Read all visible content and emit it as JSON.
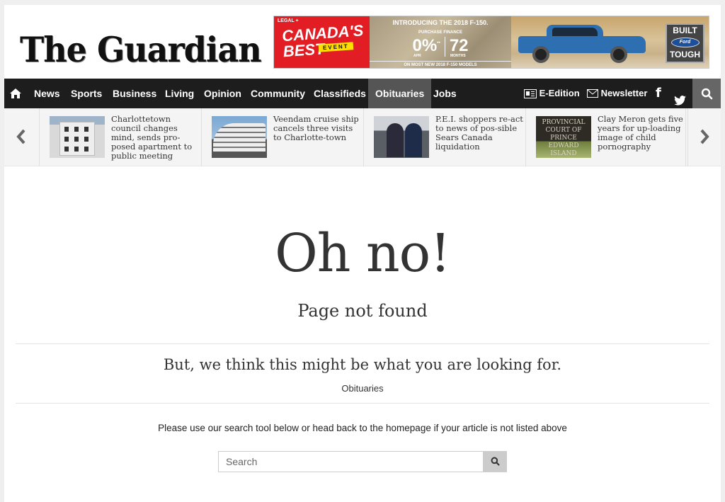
{
  "header": {
    "logo": "The Guardian",
    "ad": {
      "legal": "LEGAL +",
      "headline": "CANADA'S BEST",
      "badge": "EVENT",
      "intro": "INTRODUCING THE 2018 F-150.",
      "purchase_finance": "PURCHASE FINANCE",
      "rate": "0%",
      "rate_sup": "**",
      "rate_label": "APR",
      "months": "72",
      "months_label": "MONTHS",
      "models": "ON MOST NEW 2018 F-150 MODELS",
      "built": "BUILT",
      "ford": "Ford",
      "tough": "TOUGH"
    }
  },
  "nav": {
    "items": [
      {
        "label": "News"
      },
      {
        "label": "Sports"
      },
      {
        "label": "Business"
      },
      {
        "label": "Living"
      },
      {
        "label": "Opinion"
      },
      {
        "label": "Community"
      },
      {
        "label": "Classifieds"
      },
      {
        "label": "Obituaries",
        "active": true
      },
      {
        "label": "Jobs"
      }
    ],
    "eedition": "E-Edition",
    "newsletter": "Newsletter"
  },
  "carousel": {
    "items": [
      {
        "title": "Charlottetown council changes mind, sends pro-posed apartment to public meeting"
      },
      {
        "title": "Veendam cruise ship cancels three visits to Charlotte-town"
      },
      {
        "title": "P.E.I. shoppers re-act to news of pos-sible Sears Canada liquidation"
      },
      {
        "title": "Clay Meron gets five years for up-loading image of child pornography",
        "thumb_text": "PROVINCIAL COURT OF PRINCE EDWARD ISLAND"
      }
    ]
  },
  "main": {
    "heading": "Oh no!",
    "subheading": "Page not found",
    "suggest": "But, we think this might be what you are looking for.",
    "suggest_link": "Obituaries",
    "help": "Please use our search tool below or head back to the homepage if your article is not listed above",
    "search_placeholder": "Search"
  }
}
